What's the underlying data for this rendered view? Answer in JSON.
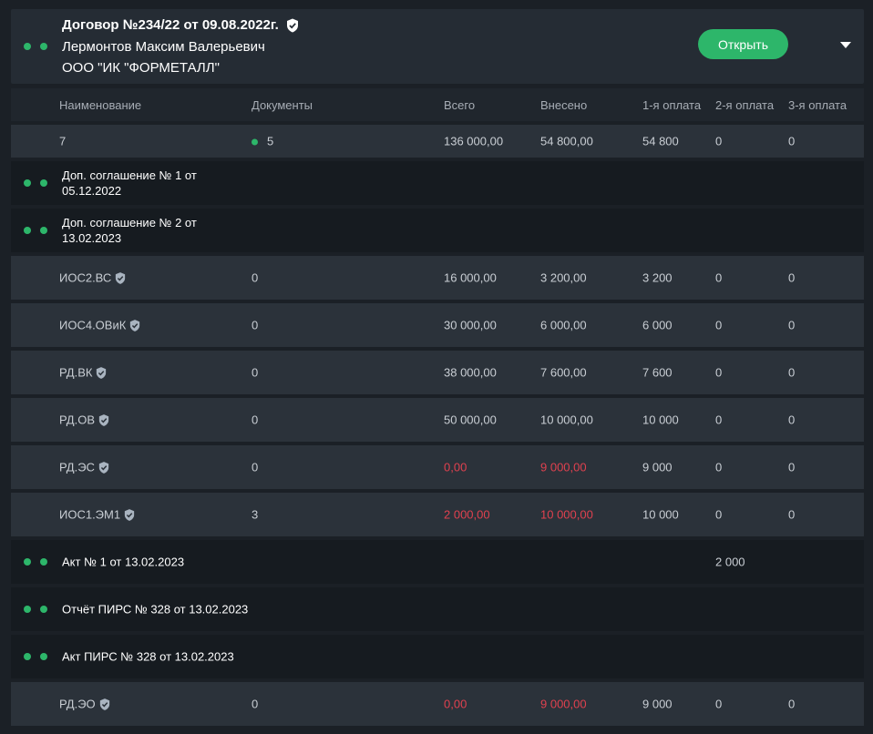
{
  "header": {
    "title": "Договор №234/22 от 09.08.2022г.",
    "person": "Лермонтов Максим Валерьевич",
    "company": "ООО \"ИК \"ФОРМЕТАЛЛ\"",
    "open_label": "Открыть"
  },
  "columns": [
    "Наименование",
    "Документы",
    "Всего",
    "Внесено",
    "1-я оплата",
    "2-я оплата",
    "3-я оплата"
  ],
  "summary": {
    "name": "7",
    "docs": "5",
    "total": "136 000,00",
    "paid": "54 800,00",
    "p1": "54 800",
    "p2": "0",
    "p3": "0"
  },
  "agreements": [
    {
      "line1": "Доп. соглашение № 1 от",
      "line2": "05.12.2022"
    },
    {
      "line1": "Доп. соглашение № 2 от",
      "line2": "13.02.2023"
    }
  ],
  "items": [
    {
      "name": "ИОС2.ВС",
      "docs": "0",
      "total": "16 000,00",
      "paid": "3 200,00",
      "p1": "3 200",
      "p2": "0",
      "p3": "0"
    },
    {
      "name": "ИОС4.ОВиК",
      "docs": "0",
      "total": "30 000,00",
      "paid": "6 000,00",
      "p1": "6 000",
      "p2": "0",
      "p3": "0"
    },
    {
      "name": "РД.ВК",
      "docs": "0",
      "total": "38 000,00",
      "paid": "7 600,00",
      "p1": "7 600",
      "p2": "0",
      "p3": "0"
    },
    {
      "name": "РД.ОВ",
      "docs": "0",
      "total": "50 000,00",
      "paid": "10 000,00",
      "p1": "10 000",
      "p2": "0",
      "p3": "0"
    },
    {
      "name": "РД.ЭС",
      "docs": "0",
      "total": "0,00",
      "paid": "9 000,00",
      "p1": "9 000",
      "p2": "0",
      "p3": "0"
    },
    {
      "name": "ИОС1.ЭМ1",
      "docs": "3",
      "total": "2 000,00",
      "paid": "10 000,00",
      "p1": "10 000",
      "p2": "0",
      "p3": "0"
    }
  ],
  "acts": [
    {
      "label": "Акт № 1 от 13.02.2023",
      "p2": "2 000"
    },
    {
      "label": "Отчёт ПИРС № 328 от 13.02.2023"
    },
    {
      "label": "Акт ПИРС № 328 от 13.02.2023"
    }
  ],
  "last_item": {
    "name": "РД.ЭО",
    "docs": "0",
    "total": "0,00",
    "paid": "9 000,00",
    "p1": "9 000",
    "p2": "0",
    "p3": "0"
  },
  "colors": {
    "accent_green": "#2db66a",
    "alert_red": "#e0414f",
    "background": "#1b2026"
  }
}
